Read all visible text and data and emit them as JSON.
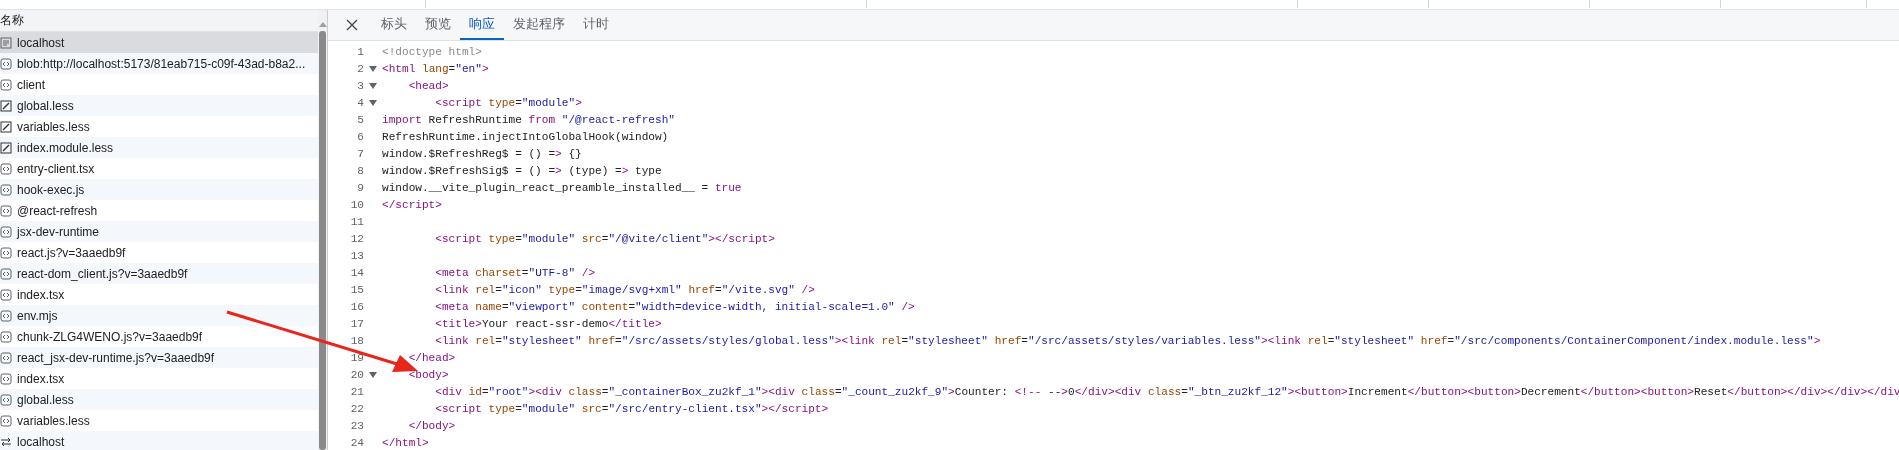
{
  "requests": {
    "header": "名称",
    "items": [
      {
        "name": "localhost",
        "kind": "document",
        "selected": true
      },
      {
        "name": "blob:http://localhost:5173/81eab715-c09f-43ad-b8a2...",
        "kind": "script",
        "selected": false
      },
      {
        "name": "client",
        "kind": "script",
        "selected": false
      },
      {
        "name": "global.less",
        "kind": "stylesheet",
        "selected": false
      },
      {
        "name": "variables.less",
        "kind": "stylesheet",
        "selected": false
      },
      {
        "name": "index.module.less",
        "kind": "stylesheet",
        "selected": false
      },
      {
        "name": "entry-client.tsx",
        "kind": "script",
        "selected": false
      },
      {
        "name": "hook-exec.js",
        "kind": "script",
        "selected": false
      },
      {
        "name": "@react-refresh",
        "kind": "script",
        "selected": false
      },
      {
        "name": "jsx-dev-runtime",
        "kind": "script",
        "selected": false
      },
      {
        "name": "react.js?v=3aaedb9f",
        "kind": "script",
        "selected": false
      },
      {
        "name": "react-dom_client.js?v=3aaedb9f",
        "kind": "script",
        "selected": false
      },
      {
        "name": "index.tsx",
        "kind": "script",
        "selected": false
      },
      {
        "name": "env.mjs",
        "kind": "script",
        "selected": false
      },
      {
        "name": "chunk-ZLG4WENO.js?v=3aaedb9f",
        "kind": "script",
        "selected": false
      },
      {
        "name": "react_jsx-dev-runtime.js?v=3aaedb9f",
        "kind": "script",
        "selected": false
      },
      {
        "name": "index.tsx",
        "kind": "script",
        "selected": false
      },
      {
        "name": "global.less",
        "kind": "script",
        "selected": false
      },
      {
        "name": "variables.less",
        "kind": "script",
        "selected": false
      },
      {
        "name": "localhost",
        "kind": "websocket",
        "selected": false
      }
    ]
  },
  "details": {
    "tabs": [
      {
        "label": "标头",
        "selected": false
      },
      {
        "label": "预览",
        "selected": false
      },
      {
        "label": "响应",
        "selected": true
      },
      {
        "label": "发起程序",
        "selected": false
      },
      {
        "label": "计时",
        "selected": false
      }
    ],
    "lines": [
      {
        "number": "1",
        "kind": "doctype",
        "foldable": false,
        "text": "<!doctype html>"
      },
      {
        "number": "2",
        "kind": "markup",
        "foldable": true,
        "text": "<html lang=\"en\">"
      },
      {
        "number": "3",
        "kind": "markup",
        "foldable": true,
        "text": "    <head>"
      },
      {
        "number": "4",
        "kind": "markup",
        "foldable": true,
        "text": "        <script type=\"module\">"
      },
      {
        "number": "5",
        "kind": "script",
        "foldable": false,
        "text": "import RefreshRuntime from \"/@react-refresh\""
      },
      {
        "number": "6",
        "kind": "script",
        "foldable": false,
        "text": "RefreshRuntime.injectIntoGlobalHook(window)"
      },
      {
        "number": "7",
        "kind": "script",
        "foldable": false,
        "text": "window.$RefreshReg$ = () => {}"
      },
      {
        "number": "8",
        "kind": "script",
        "foldable": false,
        "text": "window.$RefreshSig$ = () => (type) => type"
      },
      {
        "number": "9",
        "kind": "script",
        "foldable": false,
        "text": "window.__vite_plugin_react_preamble_installed__ = true"
      },
      {
        "number": "10",
        "kind": "markup",
        "foldable": false,
        "text": "</script>"
      },
      {
        "number": "11",
        "foldable": false
      },
      {
        "number": "12",
        "kind": "markup",
        "foldable": false,
        "text": "        <script type=\"module\" src=\"/@vite/client\"></script>"
      },
      {
        "number": "13",
        "foldable": false
      },
      {
        "number": "14",
        "kind": "markup",
        "foldable": false,
        "text": "        <meta charset=\"UTF-8\" />"
      },
      {
        "number": "15",
        "kind": "markup",
        "foldable": false,
        "text": "        <link rel=\"icon\" type=\"image/svg+xml\" href=\"/vite.svg\" />"
      },
      {
        "number": "16",
        "kind": "markup",
        "foldable": false,
        "text": "        <meta name=\"viewport\" content=\"width=device-width, initial-scale=1.0\" />"
      },
      {
        "number": "17",
        "kind": "markup",
        "foldable": false,
        "text": "        <title>Your react-ssr-demo</title>"
      },
      {
        "number": "18",
        "kind": "markup",
        "foldable": false,
        "text": "        <link rel=\"stylesheet\" href=\"/src/assets/styles/global.less\"><link rel=\"stylesheet\" href=\"/src/assets/styles/variables.less\"><link rel=\"stylesheet\" href=\"/src/components/ContainerComponent/index.module.less\">"
      },
      {
        "number": "19",
        "kind": "markup",
        "foldable": false,
        "text": "    </head>"
      },
      {
        "number": "20",
        "kind": "markup",
        "foldable": true,
        "text": "    <body>"
      },
      {
        "number": "21",
        "kind": "markup",
        "foldable": false,
        "text": "        <div id=\"root\"><div class=\"_containerBox_zu2kf_1\"><div class=\"_count_zu2kf_9\">Counter: <!-- -->0</div><div class=\"_btn_zu2kf_12\"><button>Increment</button><button>Decrement</button><button>Reset</button></div></div></div"
      },
      {
        "number": "22",
        "kind": "markup",
        "foldable": false,
        "text": "        <script type=\"module\" src=\"/src/entry-client.tsx\"></script>"
      },
      {
        "number": "23",
        "kind": "markup",
        "foldable": false,
        "text": "    </body>"
      },
      {
        "number": "24",
        "kind": "markup",
        "foldable": false,
        "text": "</html>"
      }
    ]
  }
}
